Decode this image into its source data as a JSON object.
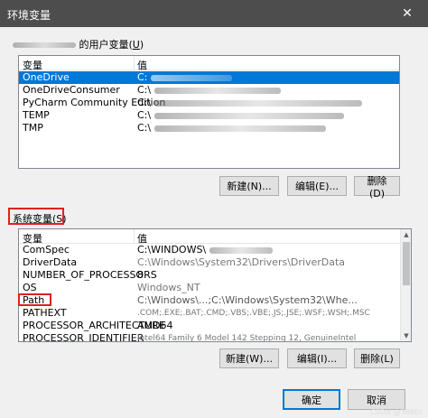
{
  "window": {
    "title": "环境变量",
    "close_glyph": "✕"
  },
  "user_section": {
    "label_suffix": "的用户变量(",
    "label_key": "U",
    "label_end": ")",
    "columns": [
      "变量",
      "值"
    ],
    "rows": [
      {
        "name": "OneDrive",
        "value": "C:",
        "selected": true
      },
      {
        "name": "OneDriveConsumer",
        "value": "C:\\",
        "selected": false
      },
      {
        "name": "PyCharm Community Edition",
        "value": "C:\\",
        "selected": false
      },
      {
        "name": "TEMP",
        "value": "C:\\",
        "selected": false
      },
      {
        "name": "TMP",
        "value": "C:\\",
        "selected": false
      }
    ],
    "buttons": {
      "new": "新建(N)...",
      "edit": "编辑(E)...",
      "delete": "删除(D)"
    }
  },
  "system_section": {
    "label": "系统变量(S)",
    "columns": [
      "变量",
      "值"
    ],
    "rows": [
      {
        "name": "ComSpec",
        "value": "C:\\WINDOWS\\"
      },
      {
        "name": "DriverData",
        "value": "C:\\Windows\\System32\\Drivers\\DriverData"
      },
      {
        "name": "NUMBER_OF_PROCESSORS",
        "value": "8"
      },
      {
        "name": "OS",
        "value": "Windows_NT"
      },
      {
        "name": "Path",
        "value": "C:\\Windows\\...;C:\\Windows\\System32\\Whe..."
      },
      {
        "name": "PATHEXT",
        "value": ".COM;.EXE;.BAT;.CMD;.VBS;.VBE;.JS;.JSE;.WSF;.WSH;.MSC"
      },
      {
        "name": "PROCESSOR_ARCHITECTURE",
        "value": "AMD64"
      },
      {
        "name": "PROCESSOR_IDENTIFIER",
        "value": "Intel64 Family 6 Model 142 Stepping 12, GenuineIntel"
      }
    ],
    "buttons": {
      "new": "新建(W)...",
      "edit": "编辑(I)...",
      "delete": "删除(L)"
    }
  },
  "footer": {
    "ok": "确定",
    "cancel": "取消"
  },
  "watermark": "CSDN @3860z"
}
